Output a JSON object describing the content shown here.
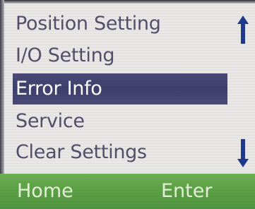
{
  "menu": {
    "items": [
      {
        "label": "Position Setting",
        "selected": false
      },
      {
        "label": "I/O Setting",
        "selected": false
      },
      {
        "label": "Error Info",
        "selected": true
      },
      {
        "label": "Service",
        "selected": false
      },
      {
        "label": "Clear Settings",
        "selected": false
      }
    ],
    "scroll_up_icon": "arrow-up-icon",
    "scroll_down_icon": "arrow-down-icon"
  },
  "softkeys": {
    "left_label": "Home",
    "right_label": "Enter"
  },
  "colors": {
    "background": "#e9e7e6",
    "text": "#50506a",
    "selection": "#42426f",
    "arrow": "#1f3a8c",
    "softkey_bar": "#5a9e44"
  }
}
